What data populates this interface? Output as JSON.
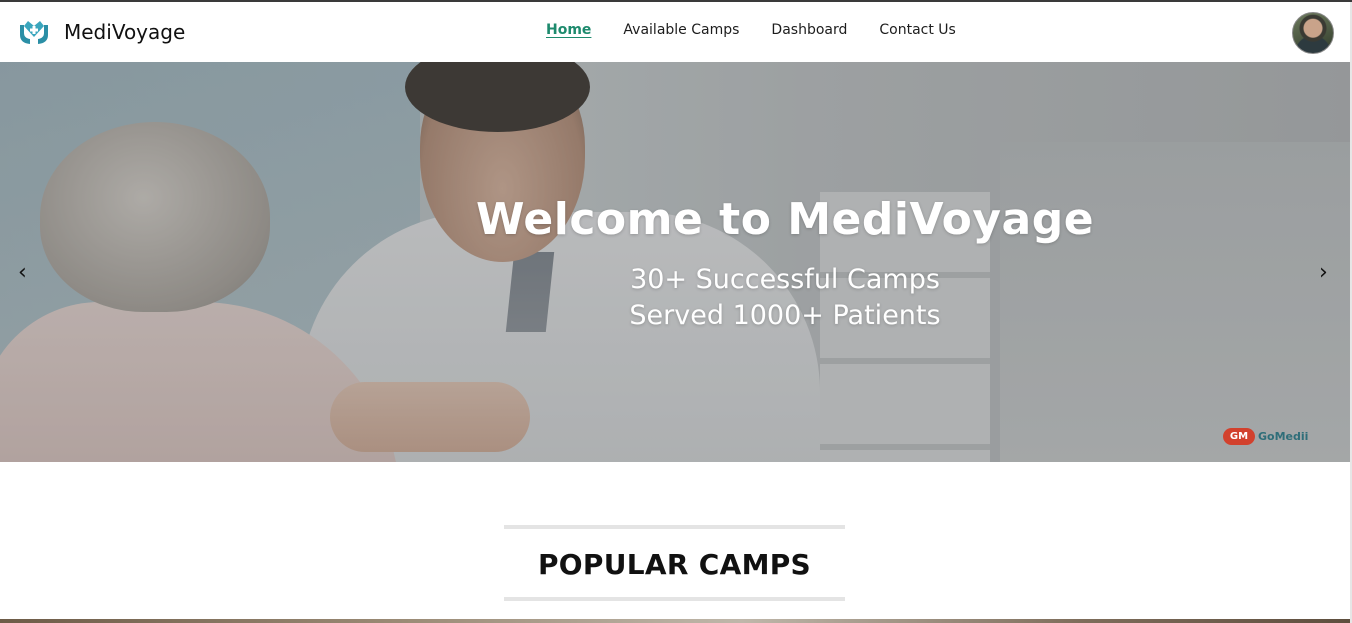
{
  "brand": {
    "name": "MediVoyage",
    "logo_icon": "hands-heart-icon",
    "accent": "#1d8a6d"
  },
  "nav": {
    "links": [
      {
        "label": "Home",
        "active": true
      },
      {
        "label": "Available Camps",
        "active": false
      },
      {
        "label": "Dashboard",
        "active": false
      },
      {
        "label": "Contact Us",
        "active": false
      }
    ]
  },
  "user": {
    "avatar_icon": "user-avatar"
  },
  "hero": {
    "title": "Welcome to MediVoyage",
    "line1": "30+ Successful Camps",
    "line2": "Served 1000+ Patients",
    "prev_arrow": "‹",
    "next_arrow": "›",
    "watermark": {
      "badge": "GM",
      "text": "GoMedii"
    }
  },
  "section": {
    "title": "POPULAR CAMPS"
  }
}
